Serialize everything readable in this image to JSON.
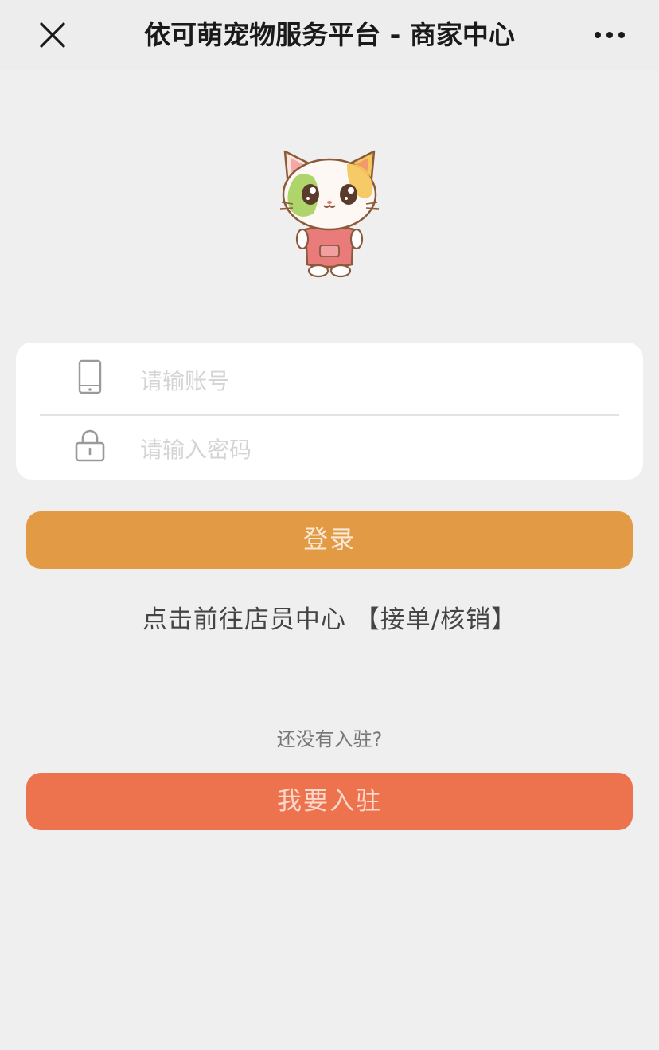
{
  "topbar": {
    "title": "依可萌宠物服务平台 - 商家中心",
    "close_icon": "close-icon",
    "more_icon": "more-icon"
  },
  "mascot": {
    "icon": "cat-mascot"
  },
  "form": {
    "account": {
      "icon": "phone-icon",
      "placeholder": "请输账号",
      "value": ""
    },
    "password": {
      "icon": "lock-icon",
      "placeholder": "请输入密码",
      "value": ""
    }
  },
  "login_button": {
    "label": "登录",
    "color": "#e29a44"
  },
  "staff_link": {
    "text": "点击前往店员中心 【接单/核销】"
  },
  "not_joined_text": "还没有入驻?",
  "join_button": {
    "label": "我要入驻",
    "color": "#ec734d"
  }
}
